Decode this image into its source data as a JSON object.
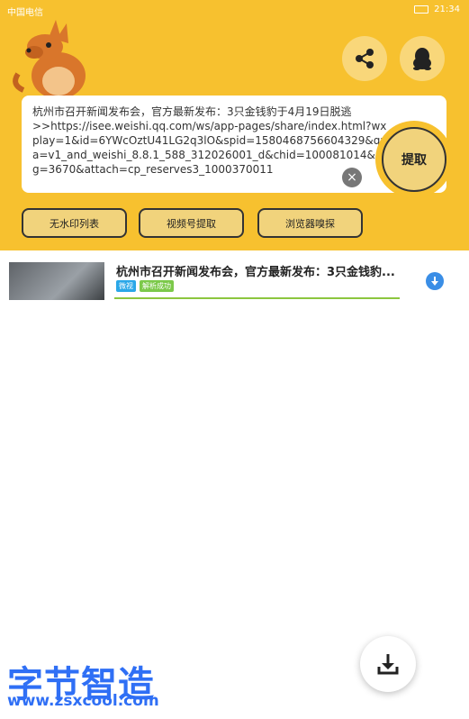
{
  "status_bar": {
    "carrier": "中国电信",
    "time": "21:34"
  },
  "header": {
    "input_text": "杭州市召开新闻发布会，官方最新发布：3只金钱豹于4月19日脱逃\n>>https://isee.weishi.qq.com/ws/app-pages/share/index.html?wxplay=1&id=6YWcOztU41LG2q3lO&spid=1580468756604329&qua=v1_and_weishi_8.8.1_588_312026001_d&chid=100081014&pkg=3670&attach=cp_reserves3_1000370011",
    "extract_label": "提取",
    "pills": [
      "无水印列表",
      "视频号提取",
      "浏览器嗅探"
    ]
  },
  "list": [
    {
      "title": "杭州市召开新闻发布会，官方最新发布：3只金钱豹...",
      "source_tag": "微视",
      "status_tag": "解析成功",
      "progress": 1.0
    }
  ],
  "watermark": {
    "chinese": "字节智造",
    "url": "www.zsxcool.com"
  },
  "colors": {
    "header": "#f7c12f",
    "button": "#f1d37c",
    "accent": "#3a8ee6",
    "progress": "#8cc63f"
  },
  "icons": [
    "share-icon",
    "qq-penguin-icon",
    "close-icon",
    "download-icon"
  ]
}
